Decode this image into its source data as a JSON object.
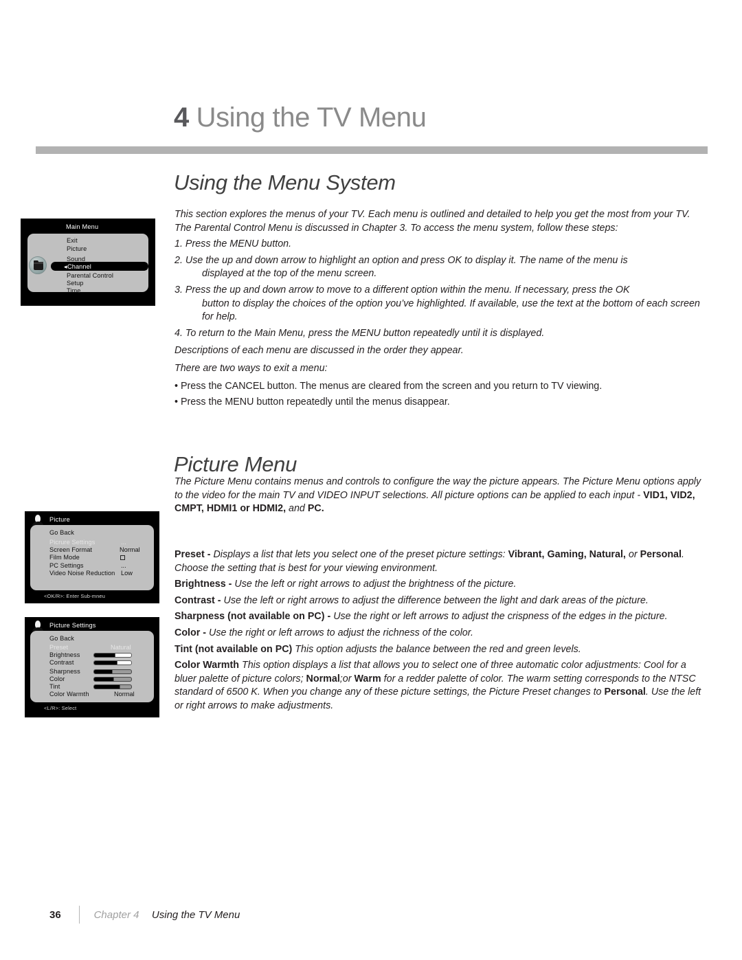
{
  "chapter": {
    "number": "4",
    "title": "Using the TV Menu"
  },
  "sections": {
    "menu_system": {
      "heading": "Using the Menu System",
      "intro": "This section explores the menus of your TV. Each menu is outlined and detailed to help you get the most from your TV. The Parental Control Menu is discussed in Chapter 3. To access the menu system, follow these steps:",
      "steps": [
        {
          "num": "1.",
          "text": "Press the MENU button.",
          "cont": ""
        },
        {
          "num": "2.",
          "text": "Use the up and down arrow to highlight an option and press OK to display it. The name of the menu is",
          "cont": "displayed at the top of the menu screen."
        },
        {
          "num": "3.",
          "text": "Press the up and down arrow to move to a different option within the menu. If necessary, press the OK",
          "cont": "button to display the choices of the option you’ve highlighted. If available, use the text at the bottom of each screen for help."
        },
        {
          "num": "4.",
          "text": "To return to the Main Menu, press the MENU button repeatedly until it is displayed.",
          "cont": ""
        }
      ],
      "note_order": "Descriptions of each menu are discussed in the order they appear.",
      "note_exit": "There are two ways to exit a menu:",
      "bullets": [
        "• Press the CANCEL button. The menus are cleared from the screen and you return to TV viewing.",
        "• Press the MENU button repeatedly until the menus disappear."
      ]
    },
    "picture_menu": {
      "heading": "Picture Menu",
      "desc_part1": "The Picture Menu contains menus and controls to configure the way the picture appears. The Picture Menu options apply to the video for the main TV and VIDEO INPUT selections. All picture options can be applied to each input - ",
      "desc_bold1": "VID1, VID2, CMPT, HDMI1 or HDMI2,",
      "desc_mid": " and ",
      "desc_bold2": "PC.",
      "terms": [
        {
          "label": "Preset",
          "sep": " -  ",
          "body1": "Displays a list that lets you select one of the preset picture settings: ",
          "bold1": "Vibrant, Gaming, Natural,",
          "body2": " or ",
          "bold2": "Personal",
          "body3": ".  Choose the setting that is best for your viewing environment."
        },
        {
          "label": "Brightness",
          "sep": " -  ",
          "body1": "Use the left or right arrows to adjust the brightness of the picture.",
          "bold1": "",
          "body2": "",
          "bold2": "",
          "body3": ""
        },
        {
          "label": "Contrast",
          "sep": " - ",
          "body1": "Use the left or right arrows to adjust the difference between the light and dark areas of the picture.",
          "bold1": "",
          "body2": "",
          "bold2": "",
          "body3": ""
        },
        {
          "label": "Sharpness (not available on PC)",
          "sep": " - ",
          "body1": "Use the right or left arrows to adjust the crispness of the edges in the picture.",
          "bold1": "",
          "body2": "",
          "bold2": "",
          "body3": ""
        },
        {
          "label": "Color",
          "sep": " - ",
          "body1": "Use the right or left arrows to adjust the richness of the color.",
          "bold1": "",
          "body2": "",
          "bold2": "",
          "body3": ""
        },
        {
          "label": "Tint (not available on PC)",
          "sep": "  ",
          "body1": "This option adjusts the balance between the red and green levels.",
          "bold1": "",
          "body2": "",
          "bold2": "",
          "body3": ""
        }
      ],
      "color_warmth": {
        "label": "Color Warmth",
        "body1": "  This option displays a list that allows you to select one of three automatic color adjustments: Cool for a bluer palette of picture colors; ",
        "bold1": "Normal",
        "body2": ";or ",
        "bold2": "Warm",
        "body3": " for a redder palette of color. The warm setting corresponds to the NTSC standard of 6500 K. When you change any of these picture settings, the Picture Preset changes to ",
        "bold3": "Personal",
        "body4": ". Use the left or right arrows to make adjustments."
      }
    }
  },
  "tv_screens": {
    "main_menu": {
      "title": "Main Menu",
      "items": [
        {
          "label": "Exit",
          "value": "",
          "highlighted": false
        },
        {
          "label": "Picture",
          "value": "",
          "highlighted": false
        },
        {
          "label": "Sound",
          "value": "",
          "highlighted": false
        },
        {
          "label": "Channel",
          "value": "",
          "highlighted": true
        },
        {
          "label": "Parental Control",
          "value": "",
          "highlighted": false
        },
        {
          "label": "Setup",
          "value": "",
          "highlighted": false
        },
        {
          "label": "Time",
          "value": "",
          "highlighted": false
        }
      ],
      "icon": "folder-icon",
      "help": ""
    },
    "picture": {
      "title": "Picture",
      "items": [
        {
          "label": "Go Back",
          "value": "",
          "dim": false
        },
        {
          "label": "Picrure Settings",
          "value": "...",
          "dim": true
        },
        {
          "label": "Screen Format",
          "value": "Normal",
          "dim": false
        },
        {
          "label": "Film Mode",
          "value": "checkbox",
          "dim": false
        },
        {
          "label": "PC Settings",
          "value": "...",
          "dim": false
        },
        {
          "label": "Video Noise Reduction",
          "value": "Low",
          "dim": false
        }
      ],
      "icon": "person-icon",
      "help": "<OK/R>: Enter Sub-mneu"
    },
    "picture_settings": {
      "title": "Picture Settings",
      "items": [
        {
          "label": "Go Back",
          "value": "",
          "dim": false,
          "slider": null
        },
        {
          "label": "Preset",
          "value": "Natural",
          "dim": true,
          "slider": null
        },
        {
          "label": "Brightness",
          "value": "",
          "dim": false,
          "slider": {
            "fill": 55,
            "style": "white"
          }
        },
        {
          "label": "Contrast",
          "value": "",
          "dim": false,
          "slider": {
            "fill": 62,
            "style": "white"
          }
        },
        {
          "label": "Sharpness",
          "value": "",
          "dim": false,
          "slider": {
            "fill": 48,
            "style": "grey"
          }
        },
        {
          "label": "Color",
          "value": "",
          "dim": false,
          "slider": {
            "fill": 52,
            "style": "grey"
          }
        },
        {
          "label": "Tint",
          "value": "",
          "dim": false,
          "slider": {
            "fill": 68,
            "style": "grey"
          }
        },
        {
          "label": "Color Warmth",
          "value": "Normal",
          "dim": false,
          "slider": null
        }
      ],
      "icon": "person-icon",
      "help": "<L/R>: Select"
    }
  },
  "footer": {
    "page": "36",
    "chapter_label": "Chapter 4",
    "title": "Using the TV Menu"
  },
  "colors": {
    "rule": "#b2b2b2",
    "heading": "#404040",
    "chapter_title": "#8a8a8a",
    "panel": "#c0c0c0",
    "tv_bg": "#000000"
  }
}
